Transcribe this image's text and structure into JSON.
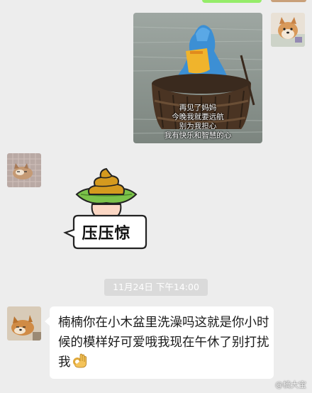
{
  "sent_image": {
    "caption_lines": [
      "再见了妈妈",
      "今晚我就要远航",
      "别为我担心",
      "我有快乐和智慧的心"
    ]
  },
  "sticker": {
    "label": "压压惊",
    "icon": "poop-on-leaf-sticker"
  },
  "timestamp": "11月24日 下午14:00",
  "message": {
    "text": "楠楠你在小木盆里洗澡吗这就是你小时候的模样好可爱哦我现在午休了别打扰我",
    "emoji": "ok-hand-icon"
  },
  "watermark": "@楠大宝",
  "colors": {
    "background": "#ededed",
    "sent_bubble": "#95ec69",
    "received_bubble": "#ffffff",
    "timestamp_bg": "#dadada"
  }
}
